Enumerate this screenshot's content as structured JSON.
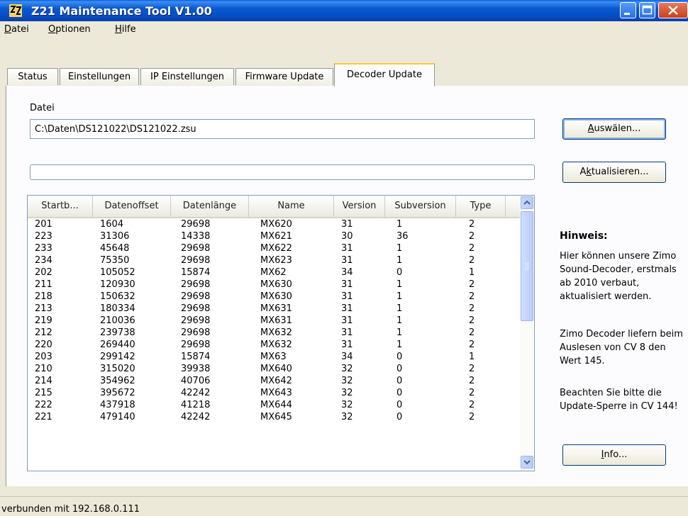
{
  "window": {
    "title": "Z21 Maintenance Tool V1.00",
    "titlebar_color": "#0a58d0"
  },
  "menu": [
    "Datei",
    "Optionen",
    "Hilfe"
  ],
  "tabs": [
    {
      "label": "Status"
    },
    {
      "label": "Einstellungen"
    },
    {
      "label": "IP Einstellungen"
    },
    {
      "label": "Firmware Update"
    },
    {
      "label": "Decoder Update",
      "active": true
    }
  ],
  "file": {
    "label": "Datei",
    "value": "C:\\Daten\\DS121022\\DS121022.zsu"
  },
  "buttons": {
    "select_prefix": "",
    "select_mnemonic": "A",
    "select_rest": "uswälen...",
    "update_prefix": "A",
    "update_mnemonic": "k",
    "update_rest": "tualisieren...",
    "info_prefix": "",
    "info_mnemonic": "I",
    "info_rest": "nfo..."
  },
  "progress": 0,
  "table": {
    "columns": [
      "Startb...",
      "Datenoffset",
      "Datenlänge",
      "Name",
      "Version",
      "Subversion",
      "Type"
    ],
    "rows": [
      [
        "201",
        "1604",
        "29698",
        "MX620",
        "31",
        "1",
        "2"
      ],
      [
        "223",
        "31306",
        "14338",
        "MX621",
        "30",
        "36",
        "2"
      ],
      [
        "233",
        "45648",
        "29698",
        "MX622",
        "31",
        "1",
        "2"
      ],
      [
        "234",
        "75350",
        "29698",
        "MX623",
        "31",
        "1",
        "2"
      ],
      [
        "202",
        "105052",
        "15874",
        "MX62",
        "34",
        "0",
        "1"
      ],
      [
        "211",
        "120930",
        "29698",
        "MX630",
        "31",
        "1",
        "2"
      ],
      [
        "218",
        "150632",
        "29698",
        "MX630",
        "31",
        "1",
        "2"
      ],
      [
        "213",
        "180334",
        "29698",
        "MX631",
        "31",
        "1",
        "2"
      ],
      [
        "219",
        "210036",
        "29698",
        "MX631",
        "31",
        "1",
        "2"
      ],
      [
        "212",
        "239738",
        "29698",
        "MX632",
        "31",
        "1",
        "2"
      ],
      [
        "220",
        "269440",
        "29698",
        "MX632",
        "31",
        "1",
        "2"
      ],
      [
        "203",
        "299142",
        "15874",
        "MX63",
        "34",
        "0",
        "1"
      ],
      [
        "210",
        "315020",
        "39938",
        "MX640",
        "32",
        "0",
        "2"
      ],
      [
        "214",
        "354962",
        "40706",
        "MX642",
        "32",
        "0",
        "2"
      ],
      [
        "215",
        "395672",
        "42242",
        "MX643",
        "32",
        "0",
        "2"
      ],
      [
        "222",
        "437918",
        "41218",
        "MX644",
        "32",
        "0",
        "2"
      ],
      [
        "221",
        "479140",
        "42242",
        "MX645",
        "32",
        "0",
        "2"
      ]
    ]
  },
  "hint": {
    "title": "Hinweis:",
    "p1": "Hier können unsere Zimo Sound-Decoder, erstmals ab 2010 verbaut, aktualisiert werden.",
    "p2": "Zimo Decoder liefern beim  Auslesen von CV 8 den Wert 145.",
    "p3": "Beachten Sie bitte die Update-Sperre in CV 144!"
  },
  "status": "verbunden mit 192.168.0.111"
}
